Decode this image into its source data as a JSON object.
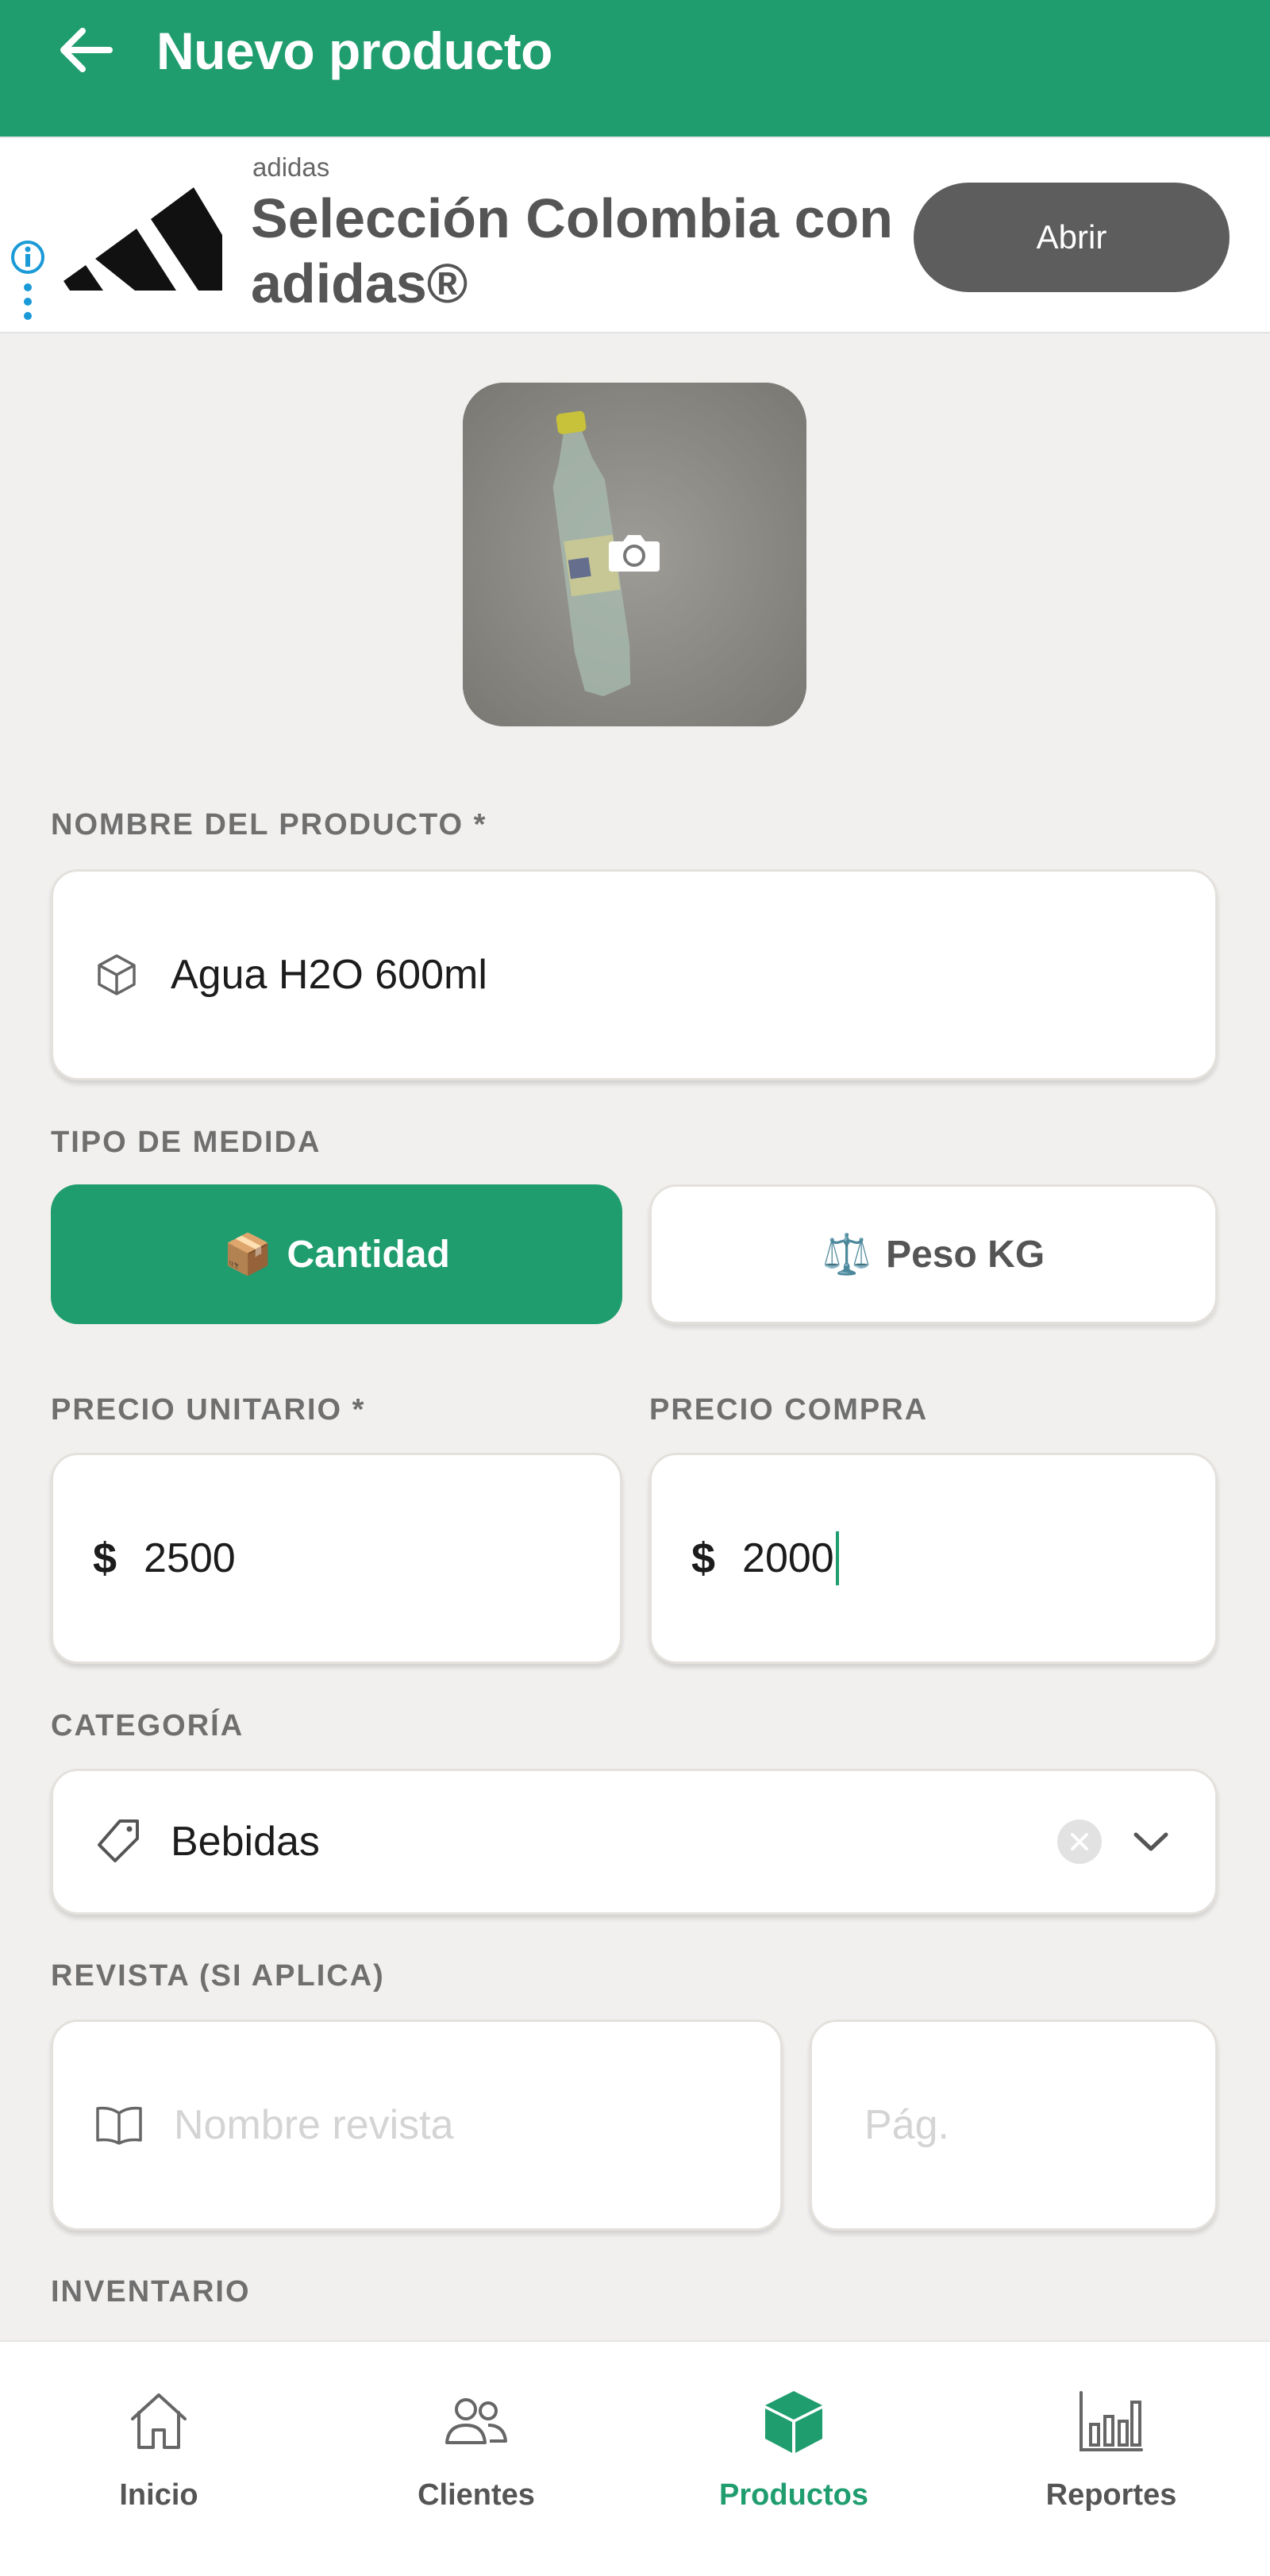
{
  "header": {
    "title": "Nuevo producto"
  },
  "ad": {
    "advertiser": "adidas",
    "headline": "Selección Colombia con adidas®",
    "cta": "Abrir"
  },
  "form": {
    "name_label": "NOMBRE DEL PRODUCTO *",
    "name_value": "Agua H2O 600ml",
    "measure_label": "TIPO DE MEDIDA",
    "measure_options": [
      {
        "emoji": "📦",
        "label": "Cantidad",
        "selected": true
      },
      {
        "emoji": "⚖️",
        "label": "Peso KG",
        "selected": false
      }
    ],
    "unit_price_label": "PRECIO UNITARIO *",
    "unit_price_currency": "$",
    "unit_price_value": "2500",
    "purchase_price_label": "PRECIO COMPRA",
    "purchase_price_currency": "$",
    "purchase_price_value": "2000",
    "category_label": "CATEGORÍA",
    "category_value": "Bebidas",
    "magazine_label": "REVISTA (SI APLICA)",
    "magazine_name_placeholder": "Nombre revista",
    "magazine_page_placeholder": "Pág.",
    "inventory_label": "INVENTARIO"
  },
  "bottom_nav": {
    "items": [
      {
        "label": "Inicio",
        "icon": "home-icon",
        "active": false
      },
      {
        "label": "Clientes",
        "icon": "users-icon",
        "active": false
      },
      {
        "label": "Productos",
        "icon": "box-icon",
        "active": true
      },
      {
        "label": "Reportes",
        "icon": "bar-chart-icon",
        "active": false
      }
    ]
  },
  "colors": {
    "primary": "#1f9d6f",
    "background": "#f2f0ee",
    "ad_button": "#5d5d5d"
  }
}
